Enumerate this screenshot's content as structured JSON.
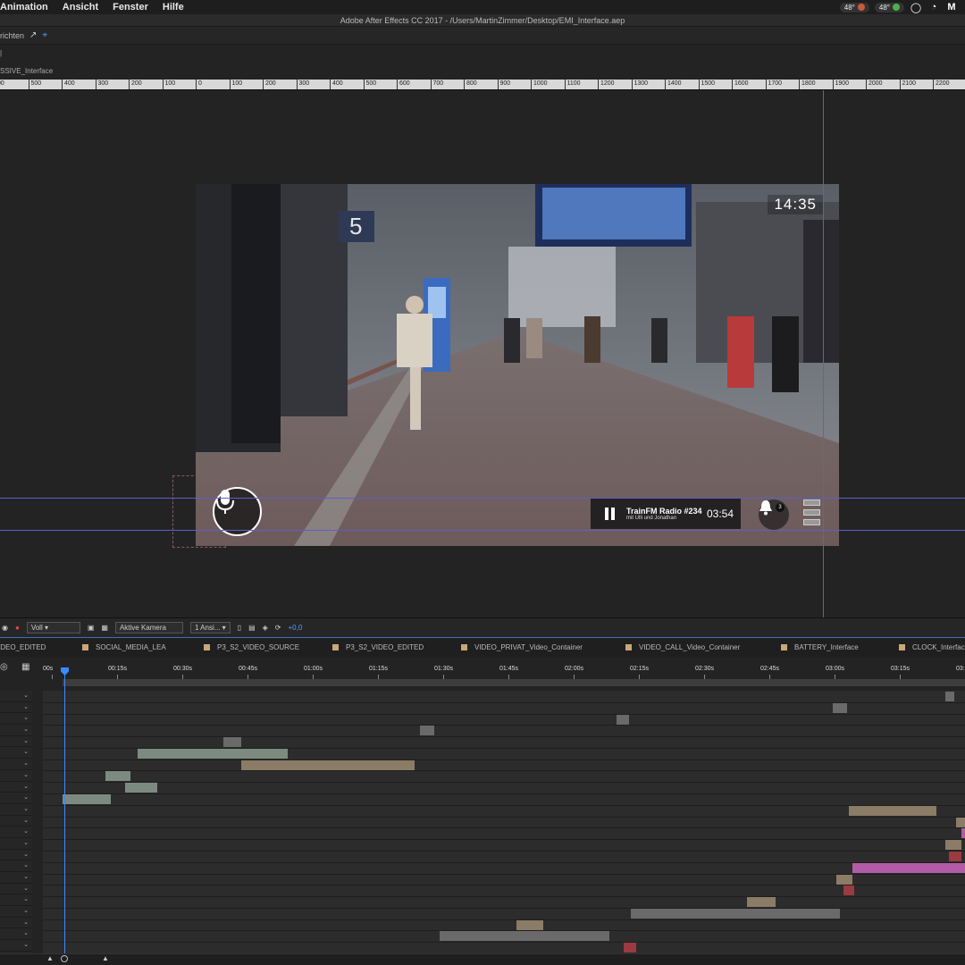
{
  "menubar": {
    "items": [
      "Animation",
      "Ansicht",
      "Fenster",
      "Hilfe"
    ],
    "tray": [
      "48°",
      "48°"
    ]
  },
  "window": {
    "title": "Adobe After Effects CC 2017 - /Users/MartinZimmer/Desktop/EMI_Interface.aep"
  },
  "toolbar": {
    "label": "richten"
  },
  "comp": {
    "tab_label": "SSIVE_Interface"
  },
  "ruler": {
    "labels": [
      "00",
      "500",
      "400",
      "300",
      "200",
      "100",
      "0",
      "100",
      "200",
      "300",
      "400",
      "500",
      "600",
      "700",
      "800",
      "900",
      "1000",
      "1100",
      "1200",
      "1300",
      "1400",
      "1500",
      "1600",
      "1700",
      "1800",
      "1900",
      "2000",
      "2100",
      "2200"
    ]
  },
  "overlay": {
    "clock": "14:35",
    "radio_title": "TrainFM Radio #234",
    "radio_subtitle": "mit Ulli und Jonathan",
    "radio_time": "03:54",
    "bell_count": "3",
    "platform_number": "5"
  },
  "viewer_toolbar": {
    "resolution": "Voll",
    "camera": "Aktive Kamera",
    "views": "1 Ansi...",
    "exposure": "+0,0"
  },
  "comp_tabs": [
    "IDEO_EDITED",
    "SOCIAL_MEDIA_LEA",
    "P3_S2_VIDEO_SOURCE",
    "P3_S2_VIDEO_EDITED",
    "VIDEO_PRIVAT_Video_Container",
    "VIDEO_CALL_Video_Container",
    "BATTERY_Interface",
    "CLOCK_Interfac"
  ],
  "timeline": {
    "labels": [
      "00s",
      "00:15s",
      "00:30s",
      "00:45s",
      "01:00s",
      "01:15s",
      "01:30s",
      "01:45s",
      "02:00s",
      "02:15s",
      "02:30s",
      "02:45s",
      "03:00s",
      "03:15s",
      "03:3"
    ],
    "layer_count": 23
  },
  "colors": {
    "accent": "#3a8bff",
    "guide": "#5e5ec8",
    "bar_green": "#7d8a80",
    "bar_tan": "#8a7c66",
    "bar_grey": "#6a6a6a",
    "bar_pink": "#b25ba6",
    "bar_red": "#9b3a40"
  }
}
